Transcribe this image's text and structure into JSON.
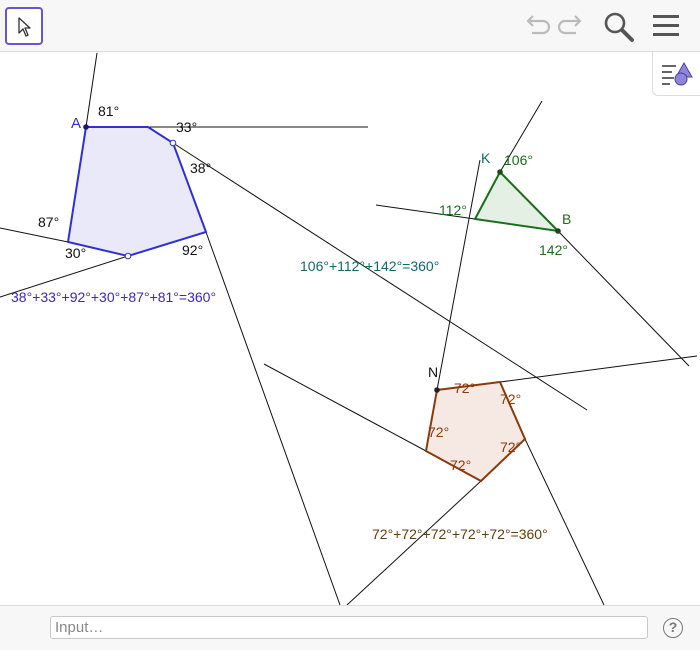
{
  "input_bar": {
    "placeholder": "Input…",
    "help_glyph": "?"
  },
  "toolbar": {
    "move_tool_icon": "cursor-arrow-icon",
    "undo_icon": "undo-icon",
    "redo_icon": "redo-icon",
    "search_icon": "search-icon",
    "menu_icon": "hamburger-menu-icon",
    "style_bar_icon": "style-bar-toggle-icon"
  },
  "colors": {
    "hexagon": "#2f2fd6",
    "triangle": "#1a6e1a",
    "pentagon": "#8b3a0b",
    "triangle_label": "#0e6b6b",
    "pentagon_label": "#6b3a0b",
    "hexagon_label": "#3a26c8",
    "move_tool_border": "#6557d2"
  },
  "hexagon": {
    "vertex_label": "A",
    "angles": [
      "81°",
      "33°",
      "38°",
      "92°",
      "30°",
      "87°"
    ],
    "sum_label": "38°+33°+92°+30°+87°+81°=360°"
  },
  "triangle": {
    "vertex_labels": [
      "K",
      "B"
    ],
    "angles": [
      "106°",
      "112°",
      "142°"
    ],
    "sum_label": "106°+112°+142°=360°"
  },
  "pentagon": {
    "vertex_label": "N",
    "angles": [
      "72°",
      "72°",
      "72°",
      "72°",
      "72°"
    ],
    "sum_label": "72°+72°+72°+72°+72°=360°"
  }
}
